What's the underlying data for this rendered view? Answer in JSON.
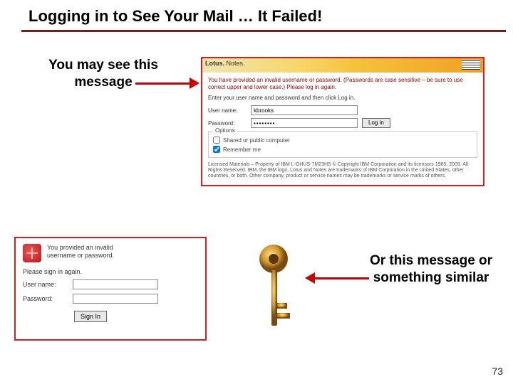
{
  "slide": {
    "title": "Logging in to See Your Mail … It Failed!",
    "lead_line1": "You may see this",
    "lead_line2": "message",
    "lead2_line1": "Or this message or",
    "lead2_line2": "something similar",
    "page_number": "73"
  },
  "shot1": {
    "brand_a": "Lotus.",
    "brand_b": "Notes.",
    "error_text": "You have provided an invalid username or password. (Passwords are case sensitive – be sure to use correct upper and lower case.) Please log in again.",
    "instruction": "Enter your user name and password and then click Log in.",
    "user_label": "User name:",
    "user_value": "kbrooks",
    "pass_label": "Password:",
    "pass_value": "••••••••",
    "login_btn": "Log in",
    "options_legend": "Options",
    "option_shared": "Shared or public computer",
    "option_remember": "Remember me",
    "option_remember_checked": true,
    "footer": "Licensed Materials – Property of IBM L-GHUS-7M23HS © Copyright IBM Corporation and its licensors 1985, 2009. All Rights Reserved. IBM, the IBM logo, Lotus and Notes are trademarks of IBM Corporation in the United States, other countries, or both. Other company, product or service names may be trademarks or service marks of others."
  },
  "shot2": {
    "error_line1": "You provided an invalid",
    "error_line2": "username or password.",
    "sub": "Please sign in again.",
    "user_label": "User name:",
    "pass_label": "Password:",
    "signin_btn": "Sign In"
  },
  "icons": {
    "error": "error-icon",
    "key": "key-icon"
  }
}
